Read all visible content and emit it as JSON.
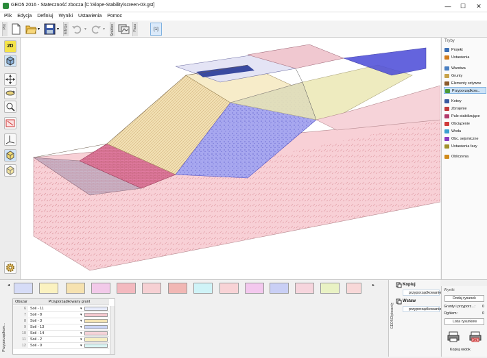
{
  "window": {
    "title": "GEO5 2016 - Stateczność zbocza [C:\\Slope-Stability\\screen-03.gst]",
    "minimize": "—",
    "maximize": "☐",
    "close": "✕"
  },
  "menu": [
    "Plik",
    "Edycja",
    "Definiuj",
    "Wyniki",
    "Ustawienia",
    "Pomoc"
  ],
  "toolbar": {
    "group_file": "Plik",
    "group_edit": "Edycja",
    "group_template": "Szablon",
    "group_frame": "Faza",
    "stage_value": "[1]"
  },
  "left_tools": {
    "mode_2d": "2D",
    "mode_3d": "3D"
  },
  "right_panel": {
    "header": "Tryby",
    "items": [
      {
        "label": "Projekt",
        "color": "#3c6fb5"
      },
      {
        "label": "Ustawienia",
        "color": "#d07a1a"
      },
      {
        "label": "Warstwa",
        "color": "#4a7fc1"
      },
      {
        "label": "Grunty",
        "color": "#c8a34a"
      },
      {
        "label": "Elementy sztywne",
        "color": "#8a5a2a"
      },
      {
        "label": "Przyporządkow...",
        "color": "#4a9a3a"
      },
      {
        "label": "Kotwy",
        "color": "#3a5aa0"
      },
      {
        "label": "Zbrojenie",
        "color": "#c03a3a"
      },
      {
        "label": "Pale stabilizujące",
        "color": "#b23a6a"
      },
      {
        "label": "Obciążenie",
        "color": "#d03a3a"
      },
      {
        "label": "Woda",
        "color": "#3aa0d0"
      },
      {
        "label": "Obc. sejsmiczne",
        "color": "#8a3ac0"
      },
      {
        "label": "Ustawienia fazy",
        "color": "#a0902a"
      },
      {
        "label": "Obliczenia",
        "color": "#d08a1a"
      }
    ]
  },
  "bottom": {
    "vertical_label": "Przyporządkow...",
    "copy_vertical_label": "GEO5Clipboard™",
    "table": {
      "headers": [
        "Obszar",
        "Przyporządkowany grunt"
      ],
      "rows": [
        {
          "num": "6",
          "soil": "Soil - 11",
          "color": "#e6eafa"
        },
        {
          "num": "7",
          "soil": "Soil - 8",
          "color": "#f5c9cf"
        },
        {
          "num": "8",
          "soil": "Soil - 3",
          "color": "#f6e6b5"
        },
        {
          "num": "9",
          "soil": "Soil - 13",
          "color": "#c9d3f5"
        },
        {
          "num": "10",
          "soil": "Soil - 14",
          "color": "#f5d2d8"
        },
        {
          "num": "11",
          "soil": "Soil - 2",
          "color": "#f7efc2"
        },
        {
          "num": "12",
          "soil": "Soil - 9",
          "color": "#d8f3f2"
        }
      ]
    },
    "copy_panel": {
      "copy_title": "Kopiuj",
      "copy_item": "przyporządkowanie",
      "paste_title": "Wstaw",
      "paste_item": "przyporządkowanie"
    },
    "output": {
      "header": "Wyniki",
      "add_image": "Dodaj rysunek",
      "line1_label": "Grunty i przyporz...:",
      "line1_value": "0",
      "line2_label": "Ogółem :",
      "line2_value": "0",
      "list_images": "Lista rysunków",
      "copy_view": "Kopiuj widok"
    }
  },
  "swatches": [
    "#d6dcf7",
    "#fbf2c0",
    "#f6e2b0",
    "#f2c9e9",
    "#f3b9bf",
    "#f6d0d3",
    "#f1b7b4",
    "#cff3f7",
    "#f8d3d6",
    "#f3c8ee",
    "#c9cff5",
    "#f6d5dd",
    "#e9f2c4",
    "#f8d8d8"
  ]
}
